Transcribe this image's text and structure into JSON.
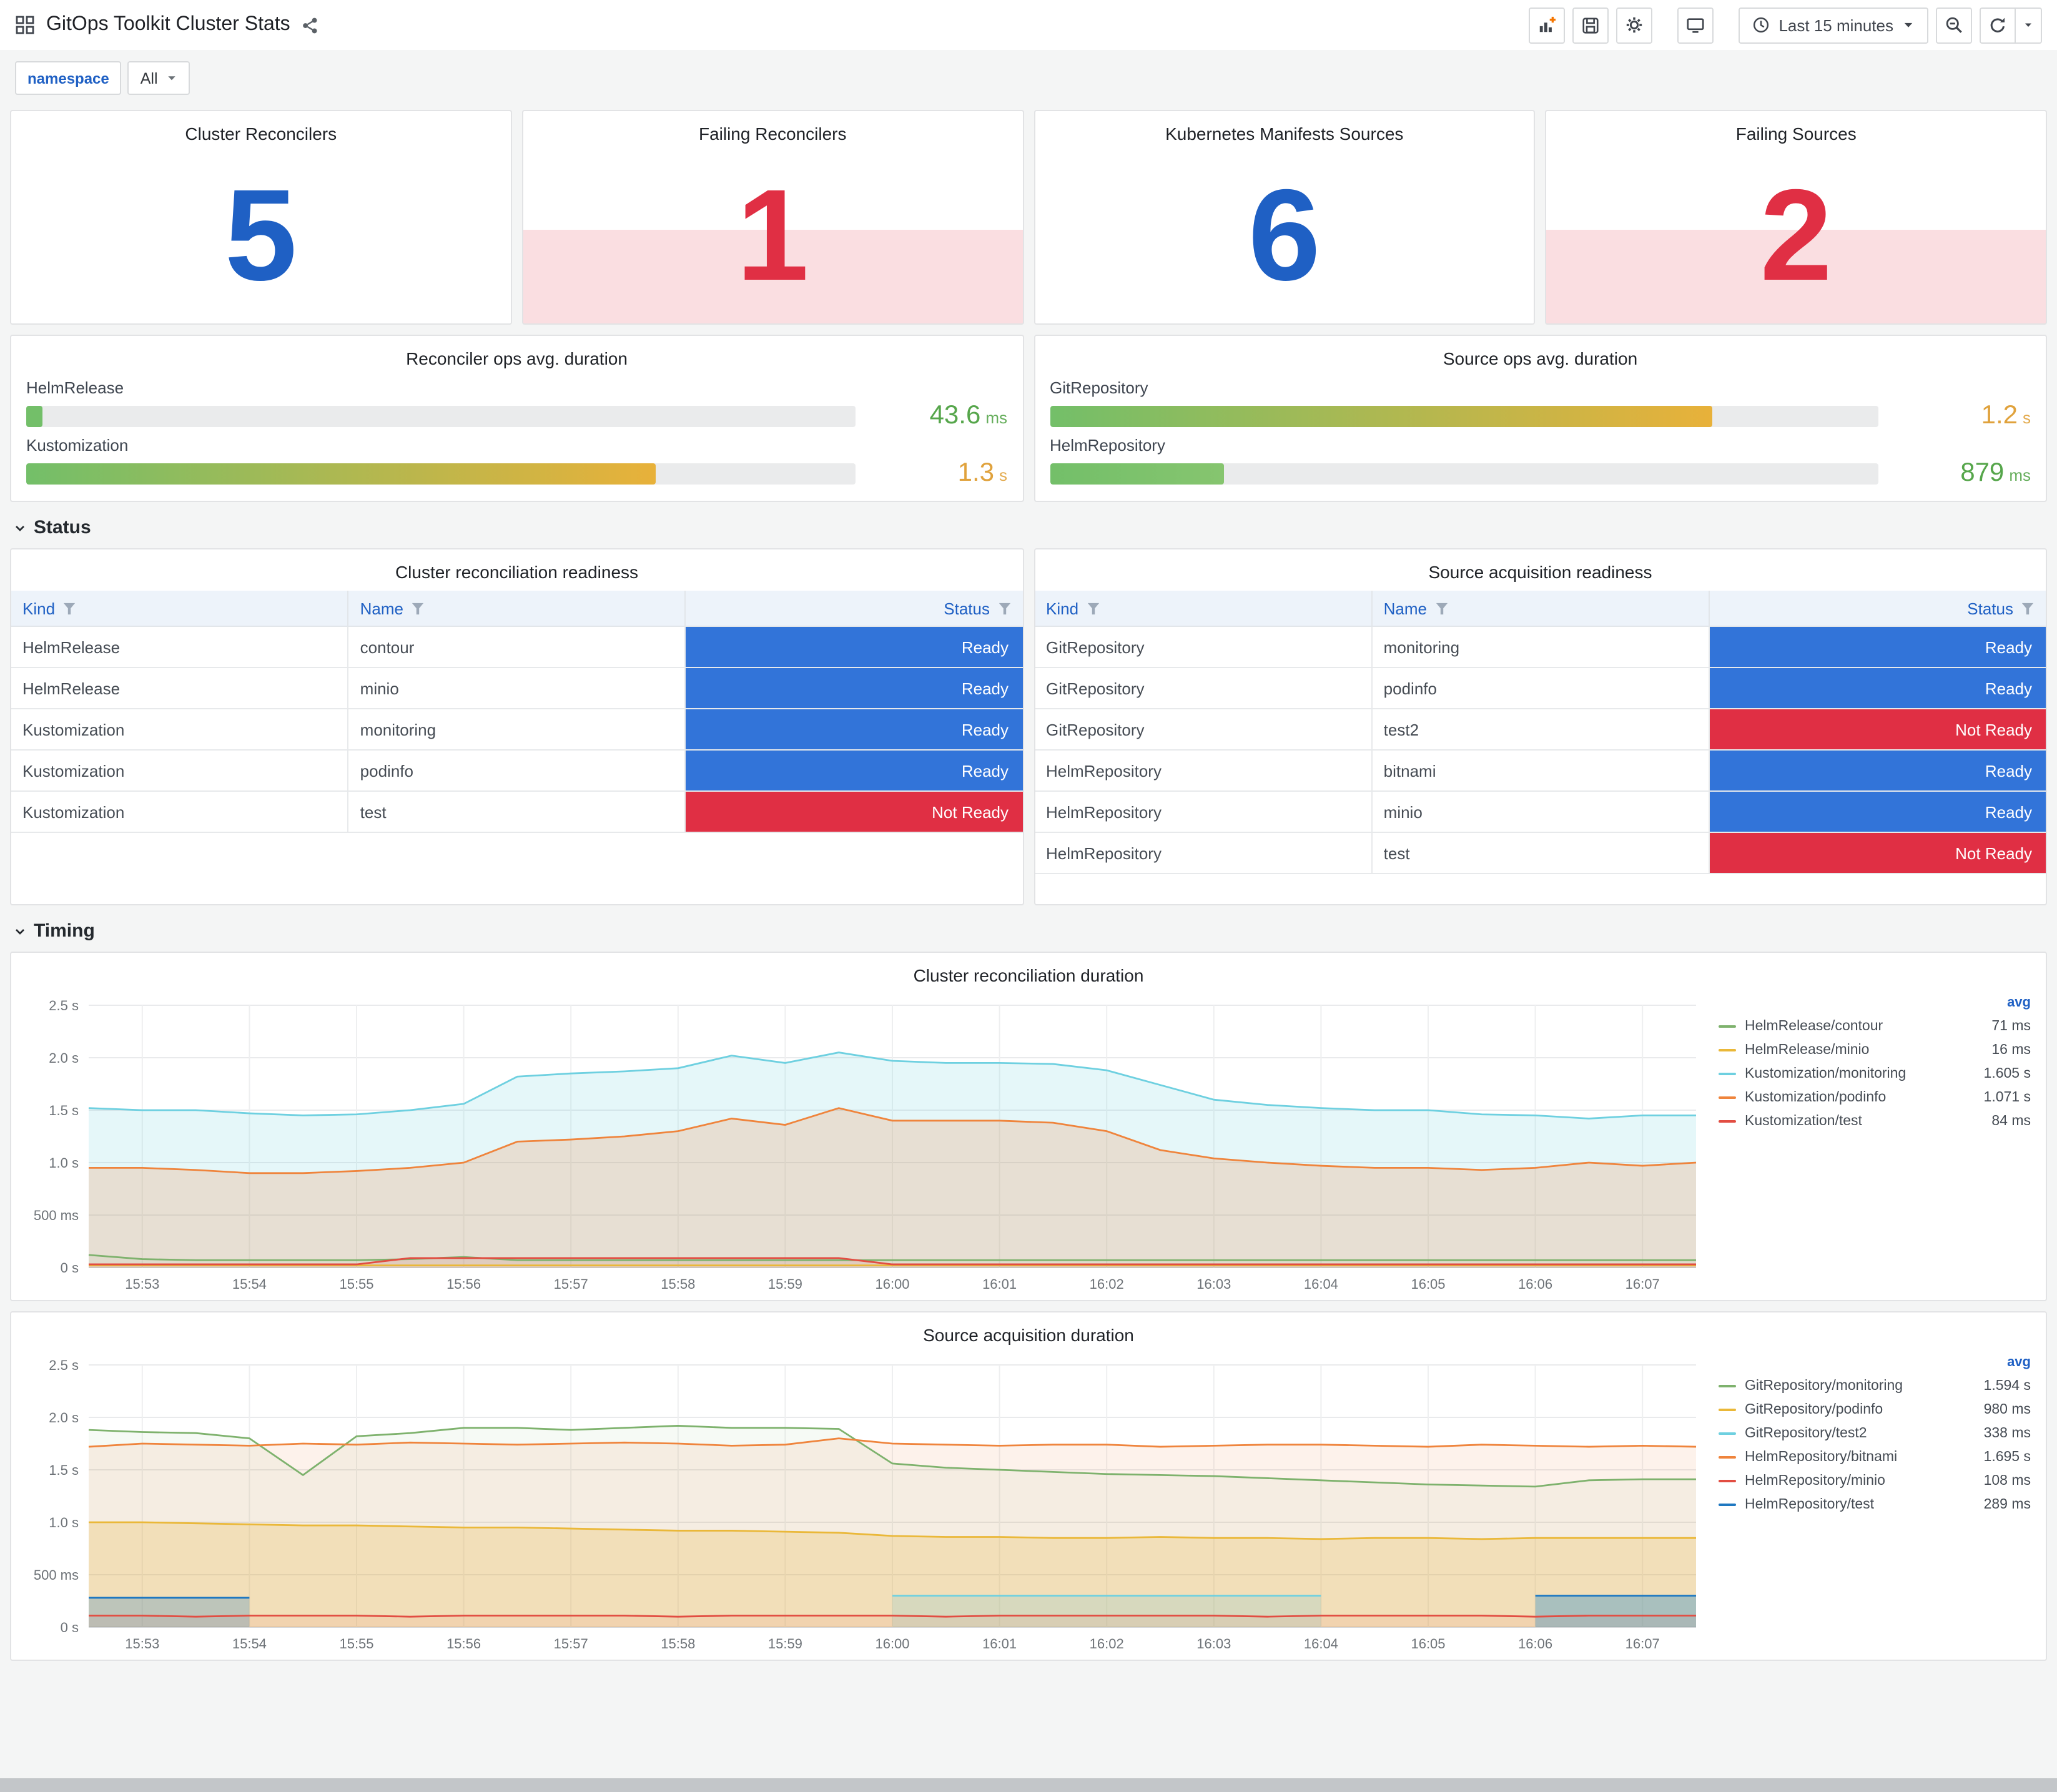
{
  "colors": {
    "blue": "#1F60C4",
    "red": "#E02F44",
    "ready_bg": "#3274D9",
    "not_ready_bg": "#E02F44"
  },
  "header": {
    "title": "GitOps Toolkit Cluster Stats",
    "time_range": "Last 15 minutes"
  },
  "variables": {
    "label": "namespace",
    "value": "All"
  },
  "stats": [
    {
      "title": "Cluster Reconcilers",
      "value": "5",
      "state": "ok"
    },
    {
      "title": "Failing Reconcilers",
      "value": "1",
      "state": "alert"
    },
    {
      "title": "Kubernetes Manifests Sources",
      "value": "6",
      "state": "ok"
    },
    {
      "title": "Failing Sources",
      "value": "2",
      "state": "alert"
    }
  ],
  "gauges": [
    {
      "title": "Reconciler ops avg. duration",
      "rows": [
        {
          "label": "HelmRelease",
          "value": "43.6",
          "unit": "ms",
          "pct": 2,
          "bar_from": "#73BF69",
          "bar_to": "#73BF69",
          "value_color": "#56A64B"
        },
        {
          "label": "Kustomization",
          "value": "1.3",
          "unit": "s",
          "pct": 76,
          "bar_from": "#73BF69",
          "bar_to": "#E8B13A",
          "value_color": "#E0A23C"
        }
      ]
    },
    {
      "title": "Source ops avg. duration",
      "rows": [
        {
          "label": "GitRepository",
          "value": "1.2",
          "unit": "s",
          "pct": 80,
          "bar_from": "#73BF69",
          "bar_to": "#E8B13A",
          "value_color": "#E0A23C"
        },
        {
          "label": "HelmRepository",
          "value": "879",
          "unit": "ms",
          "pct": 21,
          "bar_from": "#73BF69",
          "bar_to": "#86C56F",
          "value_color": "#56A64B"
        }
      ]
    }
  ],
  "sections": {
    "status": "Status",
    "timing": "Timing"
  },
  "tables": [
    {
      "title": "Cluster reconciliation readiness",
      "columns": [
        "Kind",
        "Name",
        "Status"
      ],
      "rows": [
        [
          "HelmRelease",
          "contour",
          "Ready"
        ],
        [
          "HelmRelease",
          "minio",
          "Ready"
        ],
        [
          "Kustomization",
          "monitoring",
          "Ready"
        ],
        [
          "Kustomization",
          "podinfo",
          "Ready"
        ],
        [
          "Kustomization",
          "test",
          "Not Ready"
        ]
      ]
    },
    {
      "title": "Source acquisition readiness",
      "columns": [
        "Kind",
        "Name",
        "Status"
      ],
      "rows": [
        [
          "GitRepository",
          "monitoring",
          "Ready"
        ],
        [
          "GitRepository",
          "podinfo",
          "Ready"
        ],
        [
          "GitRepository",
          "test2",
          "Not Ready"
        ],
        [
          "HelmRepository",
          "bitnami",
          "Ready"
        ],
        [
          "HelmRepository",
          "minio",
          "Ready"
        ],
        [
          "HelmRepository",
          "test",
          "Not Ready"
        ]
      ]
    }
  ],
  "chart_data": [
    {
      "type": "line",
      "title": "Cluster reconciliation duration",
      "legend_header": "avg",
      "y_max": 2.5,
      "y_ticks": [
        [
          0,
          "0 s"
        ],
        [
          0.5,
          "500 ms"
        ],
        [
          1,
          "1.0 s"
        ],
        [
          1.5,
          "1.5 s"
        ],
        [
          2,
          "2.0 s"
        ],
        [
          2.5,
          "2.5 s"
        ]
      ],
      "x_labels": [
        "15:53",
        "15:54",
        "15:55",
        "15:56",
        "15:57",
        "15:58",
        "15:59",
        "16:00",
        "16:01",
        "16:02",
        "16:03",
        "16:04",
        "16:05",
        "16:06",
        "16:07"
      ],
      "series": [
        {
          "name": "HelmRelease/contour",
          "avg": "71 ms",
          "color": "#7EB26D",
          "fill": 0.08,
          "values": [
            0.12,
            0.08,
            0.07,
            0.07,
            0.07,
            0.07,
            0.08,
            0.1,
            0.07,
            0.07,
            0.07,
            0.07,
            0.07,
            0.07,
            0.07,
            0.07,
            0.07,
            0.07,
            0.07,
            0.07,
            0.07,
            0.07,
            0.07,
            0.07,
            0.07,
            0.07,
            0.07,
            0.07,
            0.07,
            0.07,
            0.07
          ]
        },
        {
          "name": "HelmRelease/minio",
          "avg": "16 ms",
          "color": "#EAB839",
          "fill": 0.06,
          "values": [
            0.02,
            0.02,
            0.02,
            0.02,
            0.02,
            0.02,
            0.02,
            0.02,
            0.02,
            0.02,
            0.02,
            0.02,
            0.02,
            0.02,
            0.02,
            0.02,
            0.02,
            0.02,
            0.02,
            0.02,
            0.02,
            0.02,
            0.02,
            0.02,
            0.02,
            0.02,
            0.02,
            0.02,
            0.02,
            0.02,
            0.02
          ]
        },
        {
          "name": "Kustomization/monitoring",
          "avg": "1.605 s",
          "color": "#6ED0E0",
          "fill": 0.18,
          "values": [
            1.52,
            1.5,
            1.5,
            1.47,
            1.45,
            1.46,
            1.5,
            1.56,
            1.82,
            1.85,
            1.87,
            1.9,
            2.02,
            1.95,
            2.05,
            1.97,
            1.95,
            1.95,
            1.94,
            1.88,
            1.74,
            1.6,
            1.55,
            1.52,
            1.5,
            1.5,
            1.46,
            1.45,
            1.42,
            1.45,
            1.45
          ]
        },
        {
          "name": "Kustomization/podinfo",
          "avg": "1.071 s",
          "color": "#EF843C",
          "fill": 0.2,
          "values": [
            0.95,
            0.95,
            0.93,
            0.9,
            0.9,
            0.92,
            0.95,
            1.0,
            1.2,
            1.22,
            1.25,
            1.3,
            1.42,
            1.36,
            1.52,
            1.4,
            1.4,
            1.4,
            1.38,
            1.3,
            1.12,
            1.04,
            1.0,
            0.97,
            0.95,
            0.95,
            0.93,
            0.95,
            1.0,
            0.97,
            1.0
          ]
        },
        {
          "name": "Kustomization/test",
          "avg": "84 ms",
          "color": "#E24D42",
          "fill": 0.1,
          "values": [
            0.03,
            0.03,
            0.03,
            0.03,
            0.03,
            0.03,
            0.09,
            0.09,
            0.09,
            0.09,
            0.09,
            0.09,
            0.09,
            0.09,
            0.09,
            0.03,
            0.03,
            0.03,
            0.03,
            0.03,
            0.03,
            0.03,
            0.03,
            0.03,
            0.03,
            0.03,
            0.03,
            0.03,
            0.03,
            0.03,
            0.03
          ]
        }
      ]
    },
    {
      "type": "line",
      "title": "Source acquisition duration",
      "legend_header": "avg",
      "y_max": 2.5,
      "y_ticks": [
        [
          0,
          "0 s"
        ],
        [
          0.5,
          "500 ms"
        ],
        [
          1,
          "1.0 s"
        ],
        [
          1.5,
          "1.5 s"
        ],
        [
          2,
          "2.0 s"
        ],
        [
          2.5,
          "2.5 s"
        ]
      ],
      "x_labels": [
        "15:53",
        "15:54",
        "15:55",
        "15:56",
        "15:57",
        "15:58",
        "15:59",
        "16:00",
        "16:01",
        "16:02",
        "16:03",
        "16:04",
        "16:05",
        "16:06",
        "16:07"
      ],
      "series": [
        {
          "name": "GitRepository/monitoring",
          "avg": "1.594 s",
          "color": "#7EB26D",
          "fill": 0.07,
          "values": [
            1.88,
            1.86,
            1.85,
            1.8,
            1.45,
            1.82,
            1.85,
            1.9,
            1.9,
            1.88,
            1.9,
            1.92,
            1.9,
            1.9,
            1.89,
            1.56,
            1.52,
            1.5,
            1.48,
            1.46,
            1.45,
            1.44,
            1.42,
            1.4,
            1.38,
            1.36,
            1.35,
            1.34,
            1.4,
            1.41,
            1.41
          ]
        },
        {
          "name": "GitRepository/podinfo",
          "avg": "980 ms",
          "color": "#EAB839",
          "fill": 0.24,
          "values": [
            1.0,
            1.0,
            0.99,
            0.98,
            0.97,
            0.97,
            0.96,
            0.95,
            0.95,
            0.94,
            0.93,
            0.92,
            0.92,
            0.91,
            0.9,
            0.87,
            0.86,
            0.86,
            0.85,
            0.85,
            0.86,
            0.85,
            0.85,
            0.84,
            0.85,
            0.85,
            0.84,
            0.85,
            0.85,
            0.85,
            0.85
          ]
        },
        {
          "name": "GitRepository/test2",
          "avg": "338 ms",
          "color": "#6ED0E0",
          "fill": 0.22,
          "values": [
            null,
            null,
            null,
            null,
            null,
            null,
            null,
            null,
            null,
            null,
            null,
            null,
            null,
            null,
            null,
            0.3,
            0.3,
            0.3,
            0.3,
            0.3,
            0.3,
            0.3,
            0.3,
            0.3,
            null,
            null,
            null,
            0.3,
            0.3,
            0.3,
            0.3
          ]
        },
        {
          "name": "HelmRepository/bitnami",
          "avg": "1.695 s",
          "color": "#EF843C",
          "fill": 0.1,
          "values": [
            1.72,
            1.75,
            1.74,
            1.73,
            1.75,
            1.74,
            1.76,
            1.75,
            1.74,
            1.75,
            1.76,
            1.75,
            1.73,
            1.74,
            1.8,
            1.75,
            1.74,
            1.73,
            1.74,
            1.74,
            1.72,
            1.73,
            1.74,
            1.74,
            1.73,
            1.72,
            1.74,
            1.73,
            1.72,
            1.73,
            1.72
          ]
        },
        {
          "name": "HelmRepository/minio",
          "avg": "108 ms",
          "color": "#E24D42",
          "fill": 0.08,
          "values": [
            0.11,
            0.11,
            0.1,
            0.11,
            0.11,
            0.11,
            0.1,
            0.11,
            0.11,
            0.11,
            0.11,
            0.1,
            0.11,
            0.11,
            0.11,
            0.11,
            0.1,
            0.11,
            0.11,
            0.11,
            0.11,
            0.11,
            0.1,
            0.11,
            0.11,
            0.11,
            0.11,
            0.1,
            0.11,
            0.11,
            0.11
          ]
        },
        {
          "name": "HelmRepository/test",
          "avg": "289 ms",
          "color": "#1F78C1",
          "fill": 0.25,
          "values": [
            0.28,
            0.28,
            0.28,
            0.28,
            null,
            null,
            null,
            null,
            null,
            null,
            null,
            null,
            null,
            null,
            null,
            null,
            null,
            null,
            null,
            null,
            null,
            null,
            null,
            null,
            null,
            null,
            null,
            0.3,
            0.3,
            0.3,
            0.3
          ]
        }
      ]
    }
  ]
}
